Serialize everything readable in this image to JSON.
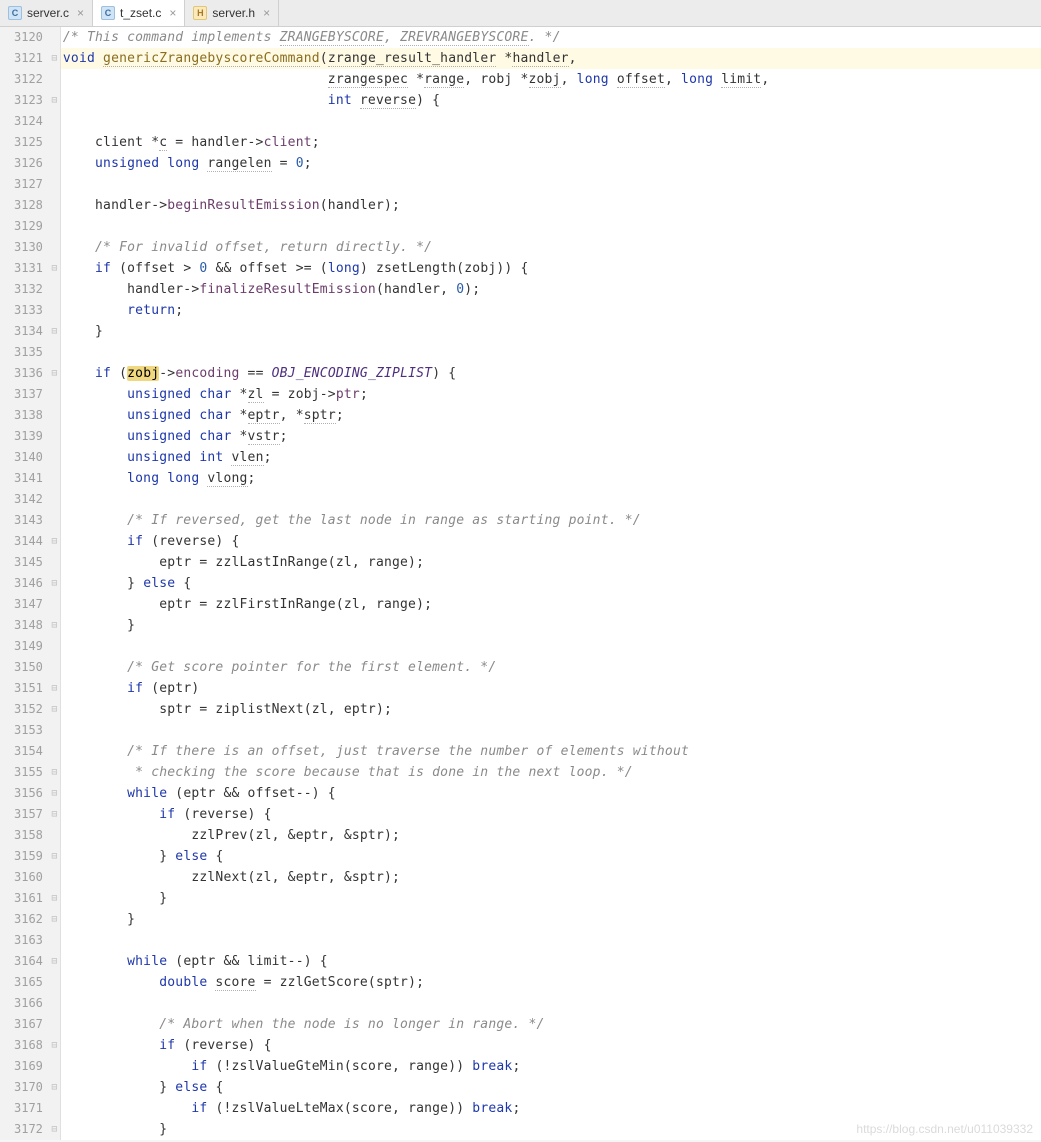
{
  "tabs": [
    {
      "label": "server.c",
      "iconType": "c",
      "active": false
    },
    {
      "label": "t_zset.c",
      "iconType": "c",
      "active": true
    },
    {
      "label": "server.h",
      "iconType": "h",
      "active": false
    }
  ],
  "startLine": 3120,
  "highlightLine": 3121,
  "highlightWord": "zobj",
  "watermark": "https://blog.csdn.net/u011039332",
  "lines": [
    {
      "n": 3120,
      "fold": "",
      "indent": 0,
      "tokens": [
        {
          "t": "/* This command implements ",
          "c": "comment"
        },
        {
          "t": "ZRANGEBYSCORE",
          "c": "comment underline-doc"
        },
        {
          "t": ", ",
          "c": "comment"
        },
        {
          "t": "ZREVRANGEBYSCORE",
          "c": "comment underline-doc"
        },
        {
          "t": ". */",
          "c": "comment"
        }
      ]
    },
    {
      "n": 3121,
      "fold": "⊟",
      "indent": 0,
      "tokens": [
        {
          "t": "void ",
          "c": "keyword"
        },
        {
          "t": "genericZrangebyscoreCommand",
          "c": "fn underline-doc"
        },
        {
          "t": "(",
          "c": "ident"
        },
        {
          "t": "zrange_result_handler",
          "c": "ident underline-doc"
        },
        {
          "t": " *",
          "c": "ident"
        },
        {
          "t": "handler",
          "c": "param underline-doc"
        },
        {
          "t": ",",
          "c": "ident"
        }
      ]
    },
    {
      "n": 3122,
      "fold": "",
      "indent": 33,
      "tokens": [
        {
          "t": "zrangespec",
          "c": "ident underline-doc"
        },
        {
          "t": " *",
          "c": "ident"
        },
        {
          "t": "range",
          "c": "param underline-doc"
        },
        {
          "t": ", robj *",
          "c": "ident"
        },
        {
          "t": "zobj",
          "c": "param underline-doc"
        },
        {
          "t": ", ",
          "c": "ident"
        },
        {
          "t": "long ",
          "c": "keyword"
        },
        {
          "t": "offset",
          "c": "param underline-doc"
        },
        {
          "t": ", ",
          "c": "ident"
        },
        {
          "t": "long ",
          "c": "keyword"
        },
        {
          "t": "limit",
          "c": "param underline-doc"
        },
        {
          "t": ",",
          "c": "ident"
        }
      ]
    },
    {
      "n": 3123,
      "fold": "⊟",
      "indent": 33,
      "tokens": [
        {
          "t": "int ",
          "c": "keyword"
        },
        {
          "t": "reverse",
          "c": "param underline-doc"
        },
        {
          "t": ") {",
          "c": "ident"
        }
      ]
    },
    {
      "n": 3124,
      "fold": "",
      "indent": 0,
      "tokens": []
    },
    {
      "n": 3125,
      "fold": "",
      "indent": 4,
      "tokens": [
        {
          "t": "client *",
          "c": "ident"
        },
        {
          "t": "c",
          "c": "ident underline-doc"
        },
        {
          "t": " = handler->",
          "c": "ident"
        },
        {
          "t": "client",
          "c": "field"
        },
        {
          "t": ";",
          "c": "ident"
        }
      ]
    },
    {
      "n": 3126,
      "fold": "",
      "indent": 4,
      "tokens": [
        {
          "t": "unsigned long ",
          "c": "keyword"
        },
        {
          "t": "rangelen",
          "c": "ident underline-doc"
        },
        {
          "t": " = ",
          "c": "ident"
        },
        {
          "t": "0",
          "c": "num"
        },
        {
          "t": ";",
          "c": "ident"
        }
      ]
    },
    {
      "n": 3127,
      "fold": "",
      "indent": 0,
      "tokens": []
    },
    {
      "n": 3128,
      "fold": "",
      "indent": 4,
      "tokens": [
        {
          "t": "handler->",
          "c": "ident"
        },
        {
          "t": "beginResultEmission",
          "c": "field"
        },
        {
          "t": "(handler);",
          "c": "ident"
        }
      ]
    },
    {
      "n": 3129,
      "fold": "",
      "indent": 0,
      "tokens": []
    },
    {
      "n": 3130,
      "fold": "",
      "indent": 4,
      "tokens": [
        {
          "t": "/* For invalid offset, return directly. */",
          "c": "comment"
        }
      ]
    },
    {
      "n": 3131,
      "fold": "⊟",
      "indent": 4,
      "tokens": [
        {
          "t": "if ",
          "c": "keyword"
        },
        {
          "t": "(offset > ",
          "c": "ident"
        },
        {
          "t": "0",
          "c": "num"
        },
        {
          "t": " && offset >= (",
          "c": "ident"
        },
        {
          "t": "long",
          "c": "keyword"
        },
        {
          "t": ") zsetLength(zobj)) {",
          "c": "ident"
        }
      ]
    },
    {
      "n": 3132,
      "fold": "",
      "indent": 8,
      "tokens": [
        {
          "t": "handler->",
          "c": "ident"
        },
        {
          "t": "finalizeResultEmission",
          "c": "field"
        },
        {
          "t": "(handler, ",
          "c": "ident"
        },
        {
          "t": "0",
          "c": "num"
        },
        {
          "t": ");",
          "c": "ident"
        }
      ]
    },
    {
      "n": 3133,
      "fold": "",
      "indent": 8,
      "tokens": [
        {
          "t": "return",
          "c": "keyword"
        },
        {
          "t": ";",
          "c": "ident"
        }
      ]
    },
    {
      "n": 3134,
      "fold": "⊟",
      "indent": 4,
      "tokens": [
        {
          "t": "}",
          "c": "ident"
        }
      ]
    },
    {
      "n": 3135,
      "fold": "",
      "indent": 0,
      "tokens": []
    },
    {
      "n": 3136,
      "fold": "⊟",
      "indent": 4,
      "tokens": [
        {
          "t": "if ",
          "c": "keyword"
        },
        {
          "t": "(",
          "c": "ident"
        },
        {
          "t": "zobj",
          "c": "highlight-word"
        },
        {
          "t": "->",
          "c": "ident"
        },
        {
          "t": "encoding",
          "c": "field"
        },
        {
          "t": " == ",
          "c": "ident"
        },
        {
          "t": "OBJ_ENCODING_ZIPLIST",
          "c": "const"
        },
        {
          "t": ") {",
          "c": "ident"
        }
      ]
    },
    {
      "n": 3137,
      "fold": "",
      "indent": 8,
      "tokens": [
        {
          "t": "unsigned char ",
          "c": "keyword"
        },
        {
          "t": "*",
          "c": "ident"
        },
        {
          "t": "zl",
          "c": "ident underline-doc"
        },
        {
          "t": " = zobj->",
          "c": "ident"
        },
        {
          "t": "ptr",
          "c": "field"
        },
        {
          "t": ";",
          "c": "ident"
        }
      ]
    },
    {
      "n": 3138,
      "fold": "",
      "indent": 8,
      "tokens": [
        {
          "t": "unsigned char ",
          "c": "keyword"
        },
        {
          "t": "*",
          "c": "ident"
        },
        {
          "t": "eptr",
          "c": "ident underline-doc"
        },
        {
          "t": ", *",
          "c": "ident"
        },
        {
          "t": "sptr",
          "c": "ident underline-doc"
        },
        {
          "t": ";",
          "c": "ident"
        }
      ]
    },
    {
      "n": 3139,
      "fold": "",
      "indent": 8,
      "tokens": [
        {
          "t": "unsigned char ",
          "c": "keyword"
        },
        {
          "t": "*",
          "c": "ident"
        },
        {
          "t": "vstr",
          "c": "ident underline-doc"
        },
        {
          "t": ";",
          "c": "ident"
        }
      ]
    },
    {
      "n": 3140,
      "fold": "",
      "indent": 8,
      "tokens": [
        {
          "t": "unsigned int ",
          "c": "keyword"
        },
        {
          "t": "vlen",
          "c": "ident underline-doc"
        },
        {
          "t": ";",
          "c": "ident"
        }
      ]
    },
    {
      "n": 3141,
      "fold": "",
      "indent": 8,
      "tokens": [
        {
          "t": "long long ",
          "c": "keyword"
        },
        {
          "t": "vlong",
          "c": "ident underline-doc"
        },
        {
          "t": ";",
          "c": "ident"
        }
      ]
    },
    {
      "n": 3142,
      "fold": "",
      "indent": 0,
      "tokens": []
    },
    {
      "n": 3143,
      "fold": "",
      "indent": 8,
      "tokens": [
        {
          "t": "/* If reversed, get the last node in range as starting point. */",
          "c": "comment"
        }
      ]
    },
    {
      "n": 3144,
      "fold": "⊟",
      "indent": 8,
      "tokens": [
        {
          "t": "if ",
          "c": "keyword"
        },
        {
          "t": "(reverse) {",
          "c": "ident"
        }
      ]
    },
    {
      "n": 3145,
      "fold": "",
      "indent": 12,
      "tokens": [
        {
          "t": "eptr = zzlLastInRange(zl, range);",
          "c": "ident"
        }
      ]
    },
    {
      "n": 3146,
      "fold": "⊟",
      "indent": 8,
      "tokens": [
        {
          "t": "} ",
          "c": "ident"
        },
        {
          "t": "else ",
          "c": "keyword"
        },
        {
          "t": "{",
          "c": "ident"
        }
      ]
    },
    {
      "n": 3147,
      "fold": "",
      "indent": 12,
      "tokens": [
        {
          "t": "eptr = zzlFirstInRange(zl, range);",
          "c": "ident"
        }
      ]
    },
    {
      "n": 3148,
      "fold": "⊟",
      "indent": 8,
      "tokens": [
        {
          "t": "}",
          "c": "ident"
        }
      ]
    },
    {
      "n": 3149,
      "fold": "",
      "indent": 0,
      "tokens": []
    },
    {
      "n": 3150,
      "fold": "",
      "indent": 8,
      "tokens": [
        {
          "t": "/* Get score pointer for the first element. */",
          "c": "comment"
        }
      ]
    },
    {
      "n": 3151,
      "fold": "⊟",
      "indent": 8,
      "tokens": [
        {
          "t": "if ",
          "c": "keyword"
        },
        {
          "t": "(eptr)",
          "c": "ident"
        }
      ]
    },
    {
      "n": 3152,
      "fold": "⊟",
      "indent": 12,
      "tokens": [
        {
          "t": "sptr = ziplistNext(zl, eptr);",
          "c": "ident"
        }
      ]
    },
    {
      "n": 3153,
      "fold": "",
      "indent": 0,
      "tokens": []
    },
    {
      "n": 3154,
      "fold": "",
      "indent": 8,
      "tokens": [
        {
          "t": "/* If there is an offset, just traverse the number of elements without",
          "c": "comment"
        }
      ]
    },
    {
      "n": 3155,
      "fold": "⊟",
      "indent": 9,
      "tokens": [
        {
          "t": "* checking the score because that is done in the next loop. */",
          "c": "comment"
        }
      ]
    },
    {
      "n": 3156,
      "fold": "⊟",
      "indent": 8,
      "tokens": [
        {
          "t": "while ",
          "c": "keyword"
        },
        {
          "t": "(eptr && offset--) {",
          "c": "ident"
        }
      ]
    },
    {
      "n": 3157,
      "fold": "⊟",
      "indent": 12,
      "tokens": [
        {
          "t": "if ",
          "c": "keyword"
        },
        {
          "t": "(reverse) {",
          "c": "ident"
        }
      ]
    },
    {
      "n": 3158,
      "fold": "",
      "indent": 16,
      "tokens": [
        {
          "t": "zzlPrev(zl, &eptr, &sptr);",
          "c": "ident"
        }
      ]
    },
    {
      "n": 3159,
      "fold": "⊟",
      "indent": 12,
      "tokens": [
        {
          "t": "} ",
          "c": "ident"
        },
        {
          "t": "else ",
          "c": "keyword"
        },
        {
          "t": "{",
          "c": "ident"
        }
      ]
    },
    {
      "n": 3160,
      "fold": "",
      "indent": 16,
      "tokens": [
        {
          "t": "zzlNext(zl, &eptr, &sptr);",
          "c": "ident"
        }
      ]
    },
    {
      "n": 3161,
      "fold": "⊟",
      "indent": 12,
      "tokens": [
        {
          "t": "}",
          "c": "ident"
        }
      ]
    },
    {
      "n": 3162,
      "fold": "⊟",
      "indent": 8,
      "tokens": [
        {
          "t": "}",
          "c": "ident"
        }
      ]
    },
    {
      "n": 3163,
      "fold": "",
      "indent": 0,
      "tokens": []
    },
    {
      "n": 3164,
      "fold": "⊟",
      "indent": 8,
      "tokens": [
        {
          "t": "while ",
          "c": "keyword"
        },
        {
          "t": "(eptr && limit--) {",
          "c": "ident"
        }
      ]
    },
    {
      "n": 3165,
      "fold": "",
      "indent": 12,
      "tokens": [
        {
          "t": "double ",
          "c": "keyword"
        },
        {
          "t": "score",
          "c": "ident underline-doc"
        },
        {
          "t": " = zzlGetScore(sptr);",
          "c": "ident"
        }
      ]
    },
    {
      "n": 3166,
      "fold": "",
      "indent": 0,
      "tokens": []
    },
    {
      "n": 3167,
      "fold": "",
      "indent": 12,
      "tokens": [
        {
          "t": "/* Abort when the node is no longer in range. */",
          "c": "comment"
        }
      ]
    },
    {
      "n": 3168,
      "fold": "⊟",
      "indent": 12,
      "tokens": [
        {
          "t": "if ",
          "c": "keyword"
        },
        {
          "t": "(reverse) {",
          "c": "ident"
        }
      ]
    },
    {
      "n": 3169,
      "fold": "",
      "indent": 16,
      "tokens": [
        {
          "t": "if ",
          "c": "keyword"
        },
        {
          "t": "(!zslValueGteMin(score, range)) ",
          "c": "ident"
        },
        {
          "t": "break",
          "c": "keyword"
        },
        {
          "t": ";",
          "c": "ident"
        }
      ]
    },
    {
      "n": 3170,
      "fold": "⊟",
      "indent": 12,
      "tokens": [
        {
          "t": "} ",
          "c": "ident"
        },
        {
          "t": "else ",
          "c": "keyword"
        },
        {
          "t": "{",
          "c": "ident"
        }
      ]
    },
    {
      "n": 3171,
      "fold": "",
      "indent": 16,
      "tokens": [
        {
          "t": "if ",
          "c": "keyword"
        },
        {
          "t": "(!zslValueLteMax(score, range)) ",
          "c": "ident"
        },
        {
          "t": "break",
          "c": "keyword"
        },
        {
          "t": ";",
          "c": "ident"
        }
      ]
    },
    {
      "n": 3172,
      "fold": "⊟",
      "indent": 12,
      "tokens": [
        {
          "t": "}",
          "c": "ident"
        }
      ]
    }
  ]
}
